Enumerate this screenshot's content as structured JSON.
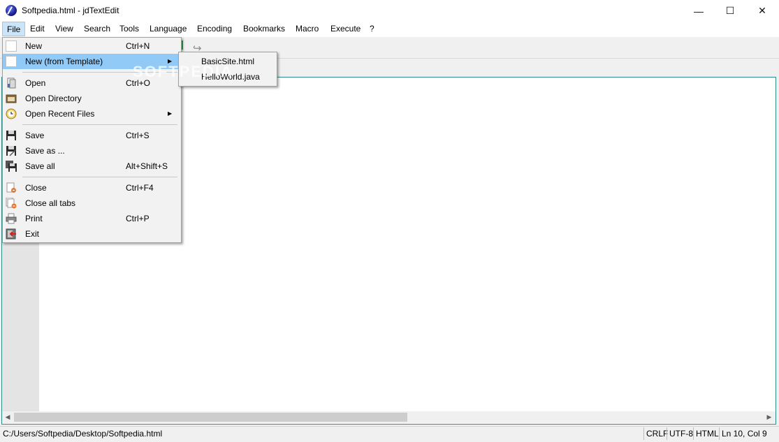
{
  "window": {
    "title": "Softpedia.html - jdTextEdit",
    "minimize_glyph": "—",
    "maximize_glyph": "☐",
    "close_glyph": "✕"
  },
  "menubar": [
    "File",
    "Edit",
    "View",
    "Search",
    "Tools",
    "Language",
    "Encoding",
    "Bookmarks",
    "Macro",
    "Execute",
    "?"
  ],
  "file_menu": {
    "items": [
      {
        "label": "New",
        "shortcut": "Ctrl+N",
        "icon": "blank-page-icon"
      },
      {
        "label": "New (from Template)",
        "shortcut": "",
        "icon": "blank-page-icon",
        "has_submenu": true,
        "highlighted": true
      },
      {
        "label": "Open",
        "shortcut": "Ctrl+O",
        "icon": "open-file-icon"
      },
      {
        "label": "Open Directory",
        "shortcut": "",
        "icon": "folder-icon"
      },
      {
        "label": "Open Recent Files",
        "shortcut": "",
        "icon": "clock-icon",
        "has_submenu": true
      },
      {
        "label": "Save",
        "shortcut": "Ctrl+S",
        "icon": "floppy-icon"
      },
      {
        "label": "Save as ...",
        "shortcut": "",
        "icon": "floppy-as-icon"
      },
      {
        "label": "Save all",
        "shortcut": "Alt+Shift+S",
        "icon": "floppy-all-icon"
      },
      {
        "label": "Close",
        "shortcut": "Ctrl+F4",
        "icon": "close-doc-icon"
      },
      {
        "label": "Close all tabs",
        "shortcut": "",
        "icon": "close-all-icon"
      },
      {
        "label": "Print",
        "shortcut": "Ctrl+P",
        "icon": "printer-icon"
      },
      {
        "label": "Exit",
        "shortcut": "",
        "icon": "exit-icon"
      }
    ],
    "submenu_arrow": "▶"
  },
  "template_submenu": [
    "BasicSite.html",
    "HelloWorld.java"
  ],
  "watermark": "SOFTPEDIA",
  "scroll": {
    "left_arrow": "◀",
    "right_arrow": "▶"
  },
  "statusbar": {
    "path": "C:/Users/Softpedia/Desktop/Softpedia.html",
    "line_ending": "CRLF",
    "encoding": "UTF-8",
    "language": "HTML",
    "position": "Ln 10, Col 9"
  },
  "colors": {
    "menu_highlight": "#91c9f7",
    "active_menu": "#cce4f7",
    "editor_border": "#2f8a8a"
  }
}
